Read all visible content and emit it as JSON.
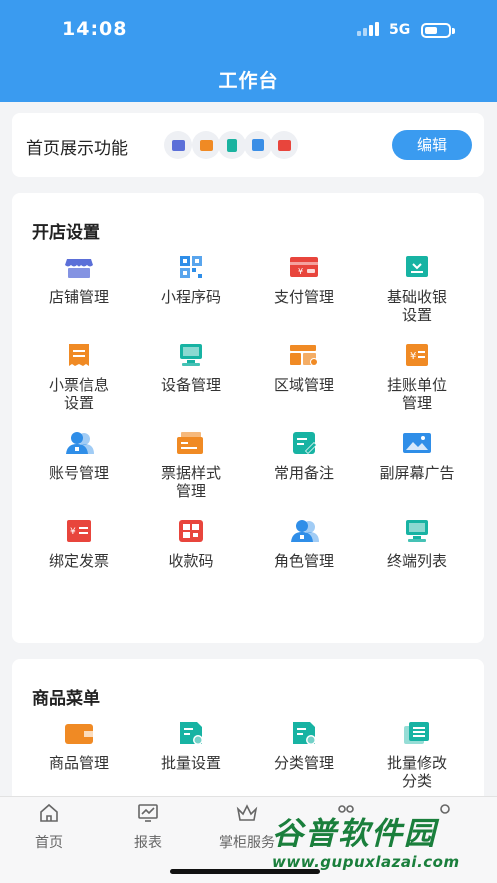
{
  "status_bar": {
    "time": "14:08",
    "network": "5G"
  },
  "header": {
    "title": "工作台"
  },
  "home_features": {
    "label": "首页展示功能",
    "edit_label": "编辑",
    "mini_icons": [
      {
        "icon": "storefront-icon",
        "color": "#5b6fd8"
      },
      {
        "icon": "wallet-icon",
        "color": "#f08a24"
      },
      {
        "icon": "document-icon",
        "color": "#1bb3a0"
      },
      {
        "icon": "qr-code-icon",
        "color": "#3a8ee6"
      },
      {
        "icon": "card-icon",
        "color": "#e8453c"
      }
    ]
  },
  "store_settings": {
    "title": "开店设置",
    "items": [
      {
        "label": "店铺管理",
        "icon": "storefront-icon",
        "color": "#5b6fd8"
      },
      {
        "label": "小程序码",
        "icon": "qr-code-icon",
        "color": "#2f8ee8"
      },
      {
        "label": "支付管理",
        "icon": "payment-card-icon",
        "color": "#e8453c"
      },
      {
        "label": "基础收银\n设置",
        "icon": "cash-register-icon",
        "color": "#17b3a3"
      },
      {
        "label": "小票信息\n设置",
        "icon": "receipt-icon",
        "color": "#f08a24"
      },
      {
        "label": "设备管理",
        "icon": "device-monitor-icon",
        "color": "#17b3a3"
      },
      {
        "label": "区域管理",
        "icon": "area-layout-icon",
        "color": "#f08a24"
      },
      {
        "label": "挂账单位\n管理",
        "icon": "credit-unit-icon",
        "color": "#f08a24"
      },
      {
        "label": "账号管理",
        "icon": "user-account-icon",
        "color": "#2f8ee8"
      },
      {
        "label": "票据样式\n管理",
        "icon": "ticket-style-icon",
        "color": "#f08a24"
      },
      {
        "label": "常用备注",
        "icon": "note-edit-icon",
        "color": "#17b3a3"
      },
      {
        "label": "副屏幕广告",
        "icon": "image-screen-icon",
        "color": "#2f8ee8"
      },
      {
        "label": "绑定发票",
        "icon": "invoice-icon",
        "color": "#e8453c"
      },
      {
        "label": "收款码",
        "icon": "payment-qr-icon",
        "color": "#e8453c"
      },
      {
        "label": "角色管理",
        "icon": "role-user-icon",
        "color": "#2f8ee8"
      },
      {
        "label": "终端列表",
        "icon": "terminal-icon",
        "color": "#17b3a3"
      }
    ]
  },
  "product_menu": {
    "title": "商品菜单",
    "items": [
      {
        "label": "商品管理",
        "icon": "product-wallet-icon",
        "color": "#f08a24"
      },
      {
        "label": "批量设置",
        "icon": "batch-settings-icon",
        "color": "#17b3a3"
      },
      {
        "label": "分类管理",
        "icon": "category-icon",
        "color": "#17b3a3"
      },
      {
        "label": "批量修改\n分类",
        "icon": "batch-edit-category-icon",
        "color": "#17b3a3"
      }
    ]
  },
  "tabbar": {
    "tabs": [
      {
        "label": "首页",
        "icon": "home-icon"
      },
      {
        "label": "报表",
        "icon": "report-chart-icon"
      },
      {
        "label": "掌柜服务",
        "icon": "crown-icon"
      },
      {
        "label": "",
        "icon": "apps-icon"
      },
      {
        "label": "",
        "icon": "profile-icon"
      }
    ]
  },
  "watermark": {
    "brand": "谷普软件园",
    "url": "www.gupuxlazai.com"
  }
}
